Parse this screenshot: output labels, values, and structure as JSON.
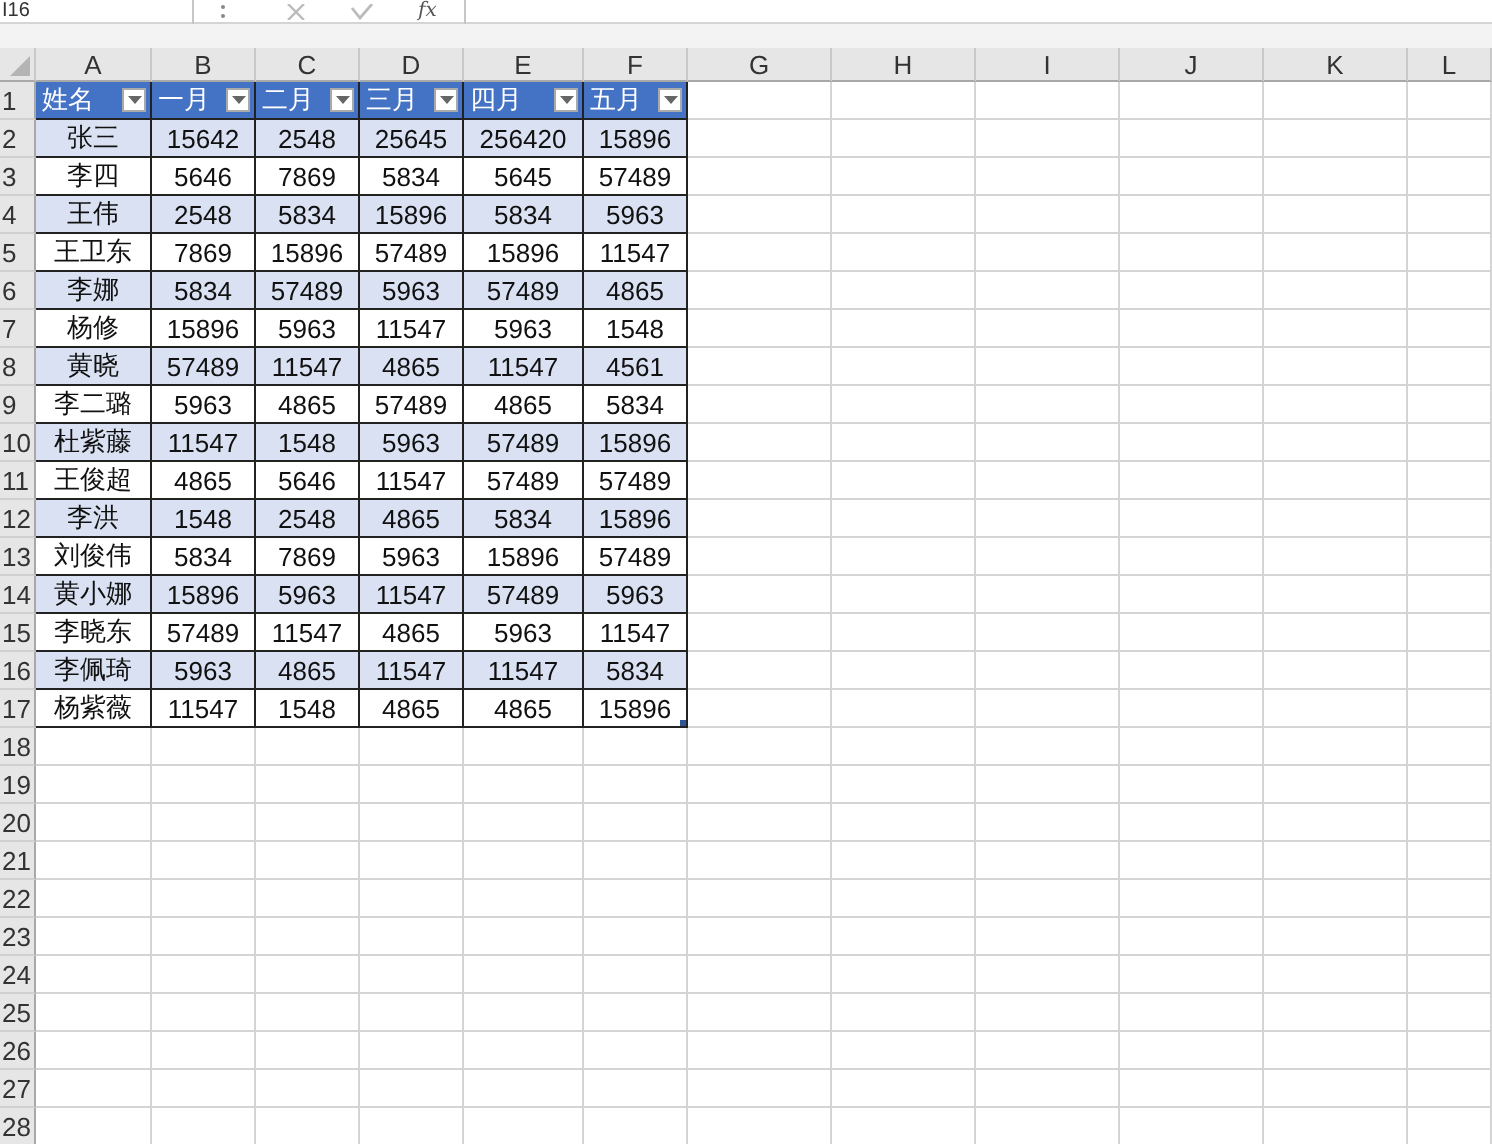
{
  "name_box": {
    "value": "I16"
  },
  "formula_bar": {
    "function_label": "fx"
  },
  "column_headers": [
    "A",
    "B",
    "C",
    "D",
    "E",
    "F",
    "G",
    "H",
    "I",
    "J",
    "K",
    "L"
  ],
  "row_headers": [
    "1",
    "2",
    "3",
    "4",
    "5",
    "6",
    "7",
    "8",
    "9",
    "10",
    "11",
    "12",
    "13",
    "14",
    "15",
    "16",
    "17",
    "18",
    "19",
    "20",
    "21",
    "22",
    "23",
    "24",
    "25",
    "26",
    "27",
    "28"
  ],
  "table": {
    "columns": [
      "姓名",
      "一月",
      "二月",
      "三月",
      "四月",
      "五月"
    ],
    "rows": [
      {
        "shaded": true,
        "cells": [
          "张三",
          "15642",
          "2548",
          "25645",
          "256420",
          "15896"
        ]
      },
      {
        "shaded": false,
        "cells": [
          "李四",
          "5646",
          "7869",
          "5834",
          "5645",
          "57489"
        ]
      },
      {
        "shaded": true,
        "cells": [
          "王伟",
          "2548",
          "5834",
          "15896",
          "5834",
          "5963"
        ]
      },
      {
        "shaded": false,
        "cells": [
          "王卫东",
          "7869",
          "15896",
          "57489",
          "15896",
          "11547"
        ]
      },
      {
        "shaded": true,
        "cells": [
          "李娜",
          "5834",
          "57489",
          "5963",
          "57489",
          "4865"
        ]
      },
      {
        "shaded": false,
        "cells": [
          "杨修",
          "15896",
          "5963",
          "11547",
          "5963",
          "1548"
        ]
      },
      {
        "shaded": true,
        "cells": [
          "黄晓",
          "57489",
          "11547",
          "4865",
          "11547",
          "4561"
        ]
      },
      {
        "shaded": false,
        "cells": [
          "李二璐",
          "5963",
          "4865",
          "57489",
          "4865",
          "5834"
        ]
      },
      {
        "shaded": true,
        "cells": [
          "杜紫藤",
          "11547",
          "1548",
          "5963",
          "57489",
          "15896"
        ]
      },
      {
        "shaded": false,
        "cells": [
          "王俊超",
          "4865",
          "5646",
          "11547",
          "57489",
          "57489"
        ]
      },
      {
        "shaded": true,
        "cells": [
          "李洪",
          "1548",
          "2548",
          "4865",
          "5834",
          "15896"
        ]
      },
      {
        "shaded": false,
        "cells": [
          "刘俊伟",
          "5834",
          "7869",
          "5963",
          "15896",
          "57489"
        ]
      },
      {
        "shaded": true,
        "cells": [
          "黄小娜",
          "15896",
          "5963",
          "11547",
          "57489",
          "5963"
        ]
      },
      {
        "shaded": false,
        "cells": [
          "李晓东",
          "57489",
          "11547",
          "4865",
          "5963",
          "11547"
        ]
      },
      {
        "shaded": true,
        "cells": [
          "李佩琦",
          "5963",
          "4865",
          "11547",
          "11547",
          "5834"
        ]
      },
      {
        "shaded": false,
        "cells": [
          "杨紫薇",
          "11547",
          "1548",
          "4865",
          "4865",
          "15896"
        ]
      }
    ]
  }
}
